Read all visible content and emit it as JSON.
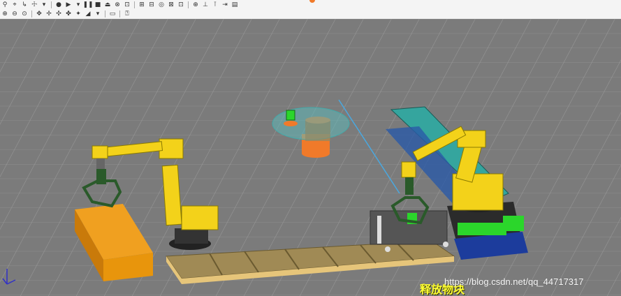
{
  "toolbar": {
    "row1": [
      {
        "name": "teach-pendant-icon",
        "glyph": "⚲"
      },
      {
        "name": "frame-icon",
        "glyph": "⌖"
      },
      {
        "name": "move-to-icon",
        "glyph": "↳"
      },
      {
        "name": "jog-icon",
        "glyph": "☩"
      },
      {
        "name": "arrow-dropdown-icon",
        "glyph": "▾"
      },
      {
        "name": "sep"
      },
      {
        "name": "record-icon",
        "glyph": "●"
      },
      {
        "name": "run-icon",
        "glyph": "▶"
      },
      {
        "name": "run-dropdown-icon",
        "glyph": "▾"
      },
      {
        "name": "pause-icon",
        "glyph": "❚❚"
      },
      {
        "name": "stop-icon",
        "glyph": "■"
      },
      {
        "name": "eject-icon",
        "glyph": "⏏"
      },
      {
        "name": "abort-icon",
        "glyph": "⊗"
      },
      {
        "name": "reset-icon",
        "glyph": "⊡"
      },
      {
        "name": "sep"
      },
      {
        "name": "cell-browser-icon",
        "glyph": "⊞"
      },
      {
        "name": "part-icon",
        "glyph": "⊟"
      },
      {
        "name": "target-icon",
        "glyph": "◎"
      },
      {
        "name": "fixture-icon",
        "glyph": "⊠"
      },
      {
        "name": "obstacle-icon",
        "glyph": "⊡"
      },
      {
        "name": "sep"
      },
      {
        "name": "profiler-icon",
        "glyph": "⊕"
      },
      {
        "name": "chart-icon",
        "glyph": "⊥"
      },
      {
        "name": "measure-icon",
        "glyph": "⊺"
      },
      {
        "name": "export-icon",
        "glyph": "⇥"
      },
      {
        "name": "settings-icon",
        "glyph": "▤"
      }
    ],
    "row2": [
      {
        "name": "zoom-in-icon",
        "glyph": "⊕"
      },
      {
        "name": "zoom-out-icon",
        "glyph": "⊖"
      },
      {
        "name": "zoom-fit-icon",
        "glyph": "⊙"
      },
      {
        "name": "sep"
      },
      {
        "name": "move-axes-icon",
        "glyph": "✥"
      },
      {
        "name": "rotate-axes-icon",
        "glyph": "✢"
      },
      {
        "name": "translate-icon",
        "glyph": "✣"
      },
      {
        "name": "rotate-icon",
        "glyph": "✤"
      },
      {
        "name": "align-icon",
        "glyph": "✦"
      },
      {
        "name": "view-dropdown-icon",
        "glyph": "◢"
      },
      {
        "name": "view-arrow-icon",
        "glyph": "▾"
      },
      {
        "name": "sep"
      },
      {
        "name": "keyboard-icon",
        "glyph": "▭"
      },
      {
        "name": "sep"
      },
      {
        "name": "lock-icon",
        "glyph": "⍰"
      }
    ]
  },
  "scene": {
    "viewport_bg": "#7b7b7b",
    "robot_color": "#f3d21a",
    "box_color": "#e8950c",
    "cylinder_color": "#f07a2a",
    "conveyor_color": "#a08a55",
    "panel_color": "#35a59e",
    "green_color": "#2bd62b"
  },
  "caption": "释放物块",
  "watermark": "https://blog.csdn.net/qq_44717317"
}
